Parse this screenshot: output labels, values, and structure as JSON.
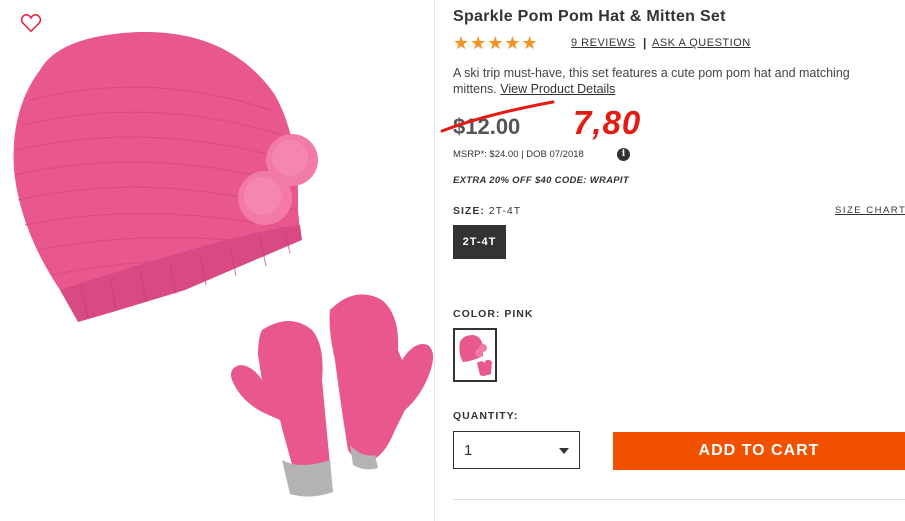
{
  "product": {
    "title": "Sparkle Pom Pom Hat & Mitten Set",
    "rating_stars": "★★★★★",
    "reviews_link": "9 REVIEWS",
    "separator": "|",
    "ask_question": "ASK A QUESTION",
    "description": "A ski trip must-have, this set features a cute pom pom hat and matching mittens.",
    "details_link": "View Product Details"
  },
  "pricing": {
    "old_price": "$12.00",
    "new_price": "7,80",
    "msrp": "MSRP*: $24.00 | DOB 07/2018",
    "info_icon": "i",
    "promo": "EXTRA 20% OFF $40 CODE: WRAPIT"
  },
  "size": {
    "label": "SIZE:",
    "value": "2T-4T",
    "chart_link": "SIZE CHART",
    "options": [
      "2T-4T"
    ]
  },
  "color": {
    "label": "COLOR: PINK"
  },
  "quantity": {
    "label": "QUANTITY:",
    "value": "1"
  },
  "cart": {
    "add_label": "ADD TO CART"
  },
  "colors": {
    "accent_orange": "#f25100",
    "price_red": "#e41b12",
    "star": "#f29222",
    "product_pink": "#e8588f"
  },
  "icons": {
    "wishlist": "heart-icon",
    "info": "info-icon",
    "dropdown": "chevron-down-icon"
  }
}
